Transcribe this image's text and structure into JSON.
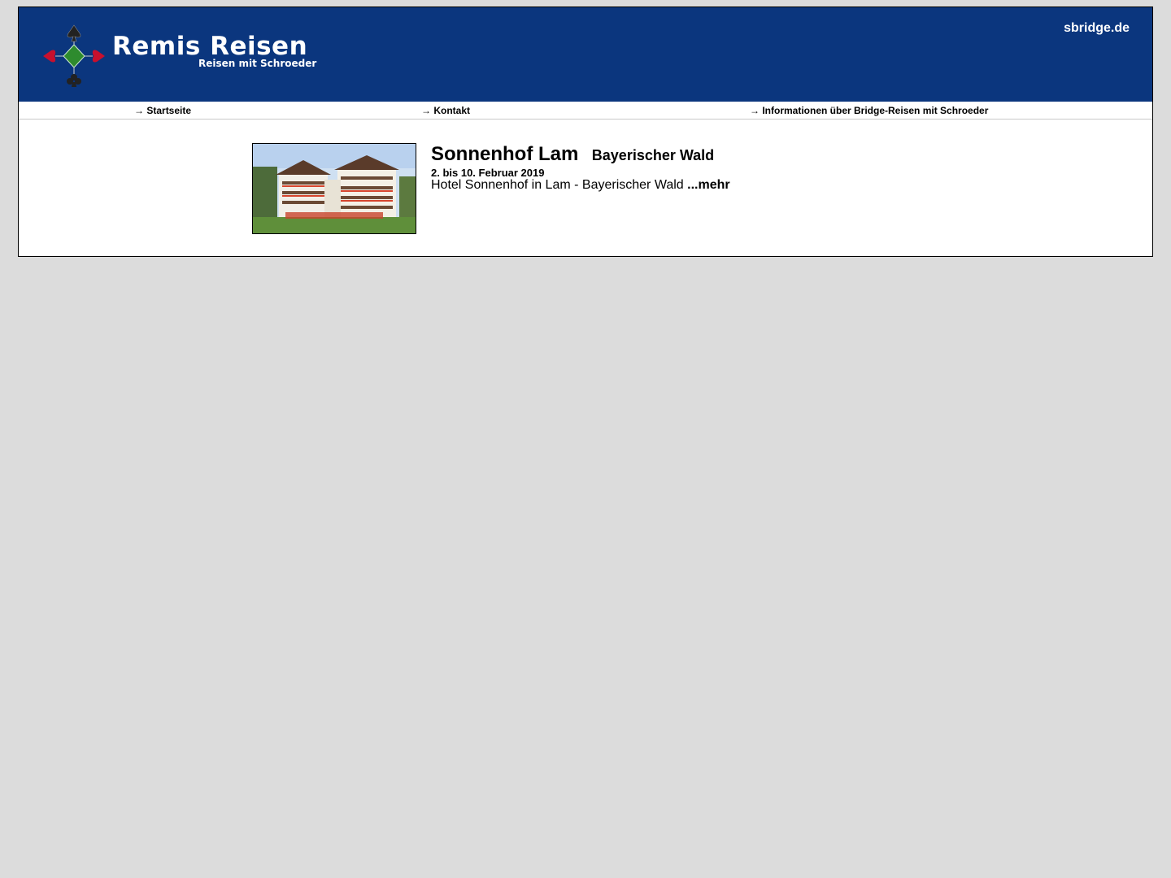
{
  "header": {
    "brand_title": "Remis Reisen",
    "brand_subtitle": "Reisen mit Schroeder",
    "site_link": "sbridge.de",
    "logo_icon": "card-suits-logo-icon",
    "background_color": "#0b367e"
  },
  "nav": {
    "arrow": "→",
    "items": [
      {
        "label": "Startseite"
      },
      {
        "label": "Kontakt"
      },
      {
        "label": "Informationen über Bridge-Reisen mit Schroeder"
      }
    ]
  },
  "trip": {
    "name": "Sonnenhof Lam",
    "region": "Bayerischer Wald",
    "dates": "2. bis 10. Februar 2019",
    "description": "Hotel Sonnenhof in Lam - Bayerischer Wald",
    "more_link": "...mehr",
    "image_icon": "hotel-photo"
  }
}
